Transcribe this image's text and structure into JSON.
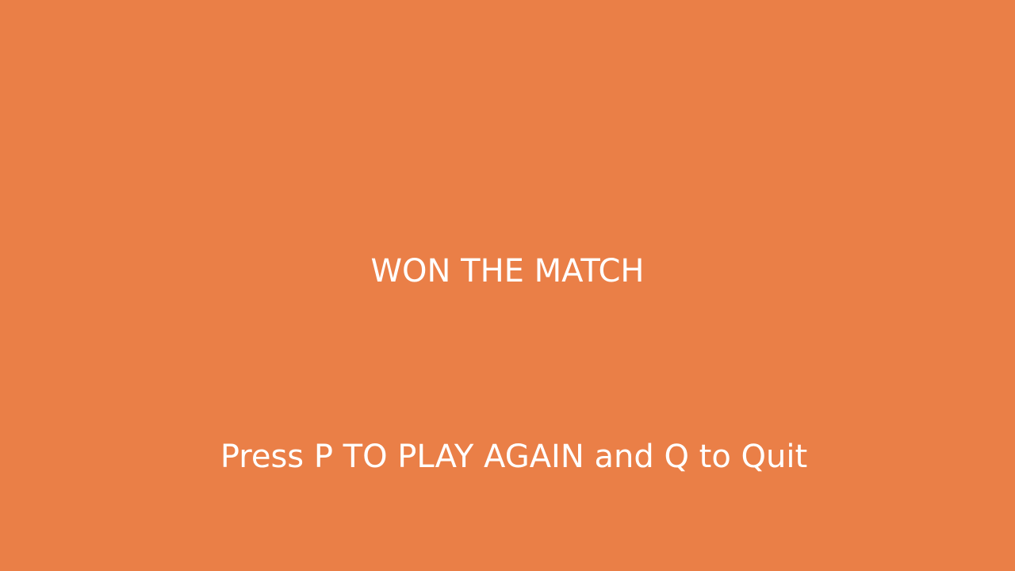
{
  "game_over": {
    "headline": "WON THE MATCH",
    "prompt": "Press P TO PLAY AGAIN and Q to Quit"
  },
  "colors": {
    "background": "#EA7F47",
    "text": "#FFFFFF"
  }
}
